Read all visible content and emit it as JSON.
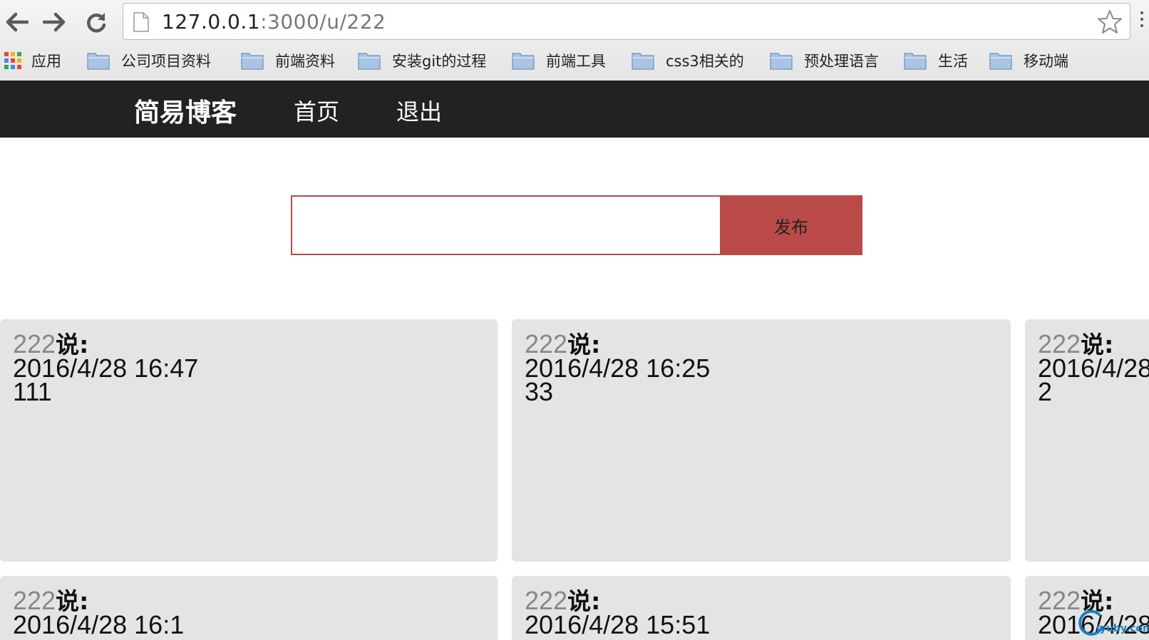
{
  "browser": {
    "url_host": "127.0.0.1",
    "url_rest": ":3000/u/222",
    "bookmarks": [
      {
        "label": "应用",
        "icon": "apps-grid-icon"
      },
      {
        "label": "公司项目资料",
        "icon": "folder-icon"
      },
      {
        "label": "前端资料",
        "icon": "folder-icon"
      },
      {
        "label": "安装git的过程",
        "icon": "folder-icon"
      },
      {
        "label": "前端工具",
        "icon": "folder-icon"
      },
      {
        "label": "css3相关的",
        "icon": "folder-icon"
      },
      {
        "label": "预处理语言",
        "icon": "folder-icon"
      },
      {
        "label": "生活",
        "icon": "folder-icon"
      },
      {
        "label": "移动端",
        "icon": "folder-icon"
      }
    ]
  },
  "navbar": {
    "brand": "简易博客",
    "links": [
      "首页",
      "退出"
    ]
  },
  "post_form": {
    "input_value": "",
    "button_label": "发布"
  },
  "posts": [
    {
      "user": "222",
      "says": "说:",
      "time": "2016/4/28 16:47",
      "content": "111"
    },
    {
      "user": "222",
      "says": "说:",
      "time": "2016/4/28 16:25",
      "content": "33"
    },
    {
      "user": "222",
      "says": "说:",
      "time": "2016/4/28",
      "content": "2"
    },
    {
      "user": "222",
      "says": "说:",
      "time": "2016/4/28 16:1",
      "content": ""
    },
    {
      "user": "222",
      "says": "说:",
      "time": "2016/4/28 15:51",
      "content": ""
    },
    {
      "user": "222",
      "says": "说:",
      "time": "2016/4/28",
      "content": ""
    }
  ],
  "watermark": {
    "text": "jyuby.com"
  },
  "colors": {
    "navbar_bg": "#222222",
    "accent": "#b94a48",
    "card_bg": "#e4e4e4"
  }
}
